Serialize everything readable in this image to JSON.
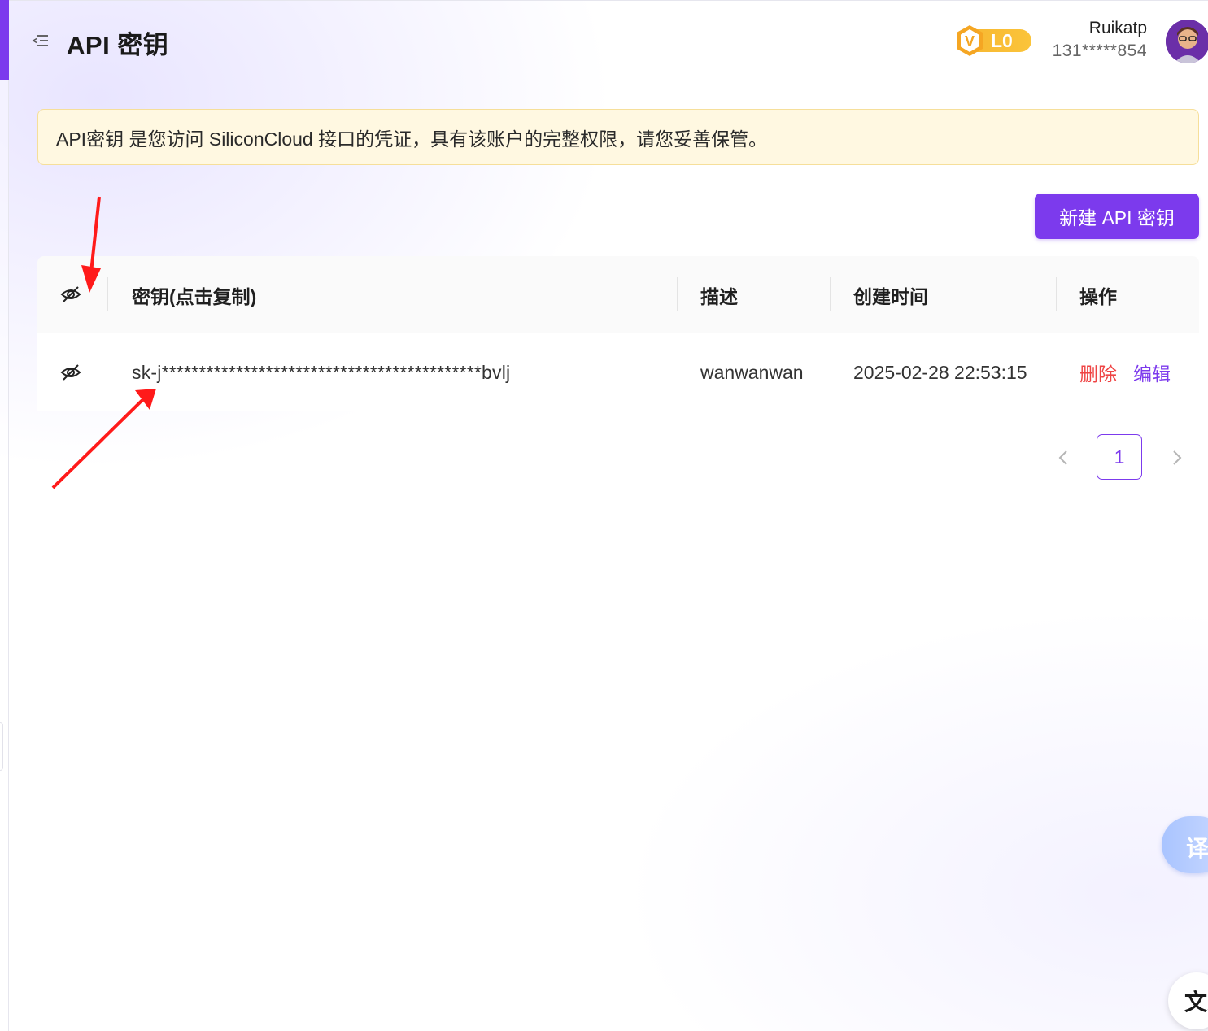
{
  "header": {
    "title": "API 密钥",
    "menu_icon": "indent-menu-icon",
    "vip": {
      "letter": "V",
      "level": "L0",
      "color": "#f7b731"
    },
    "user": {
      "name": "Ruikatp",
      "phone": "131*****854"
    }
  },
  "notice": {
    "text": "API密钥 是您访问 SiliconCloud 接口的凭证，具有该账户的完整权限，请您妥善保管。"
  },
  "actions": {
    "new_key_label": "新建 API 密钥"
  },
  "table": {
    "columns": {
      "key": "密钥(点击复制)",
      "description": "描述",
      "created": "创建时间",
      "operations": "操作"
    },
    "rows": [
      {
        "key": "sk-j*******************************************bvlj",
        "description": "wanwanwan",
        "created": "2025-02-28 22:53:15",
        "delete_label": "删除",
        "edit_label": "编辑"
      }
    ]
  },
  "pagination": {
    "current_page": "1"
  },
  "floating": {
    "translate_label": "译",
    "translate_icon_label": "文A"
  },
  "colors": {
    "accent": "#7c3aed",
    "danger": "#ef4444",
    "notice_bg": "#fff8e1",
    "annotation_arrow": "#ff1a1a"
  }
}
